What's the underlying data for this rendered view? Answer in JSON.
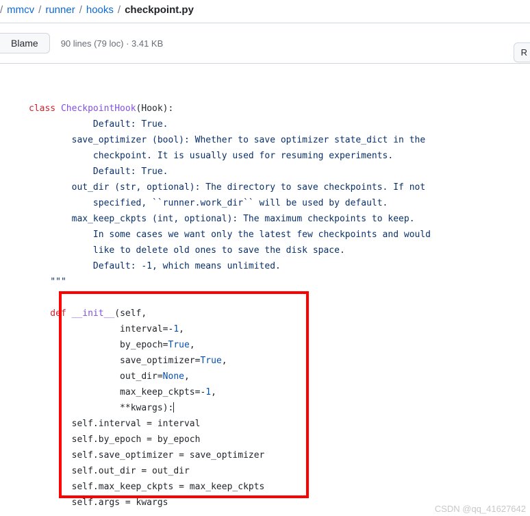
{
  "breadcrumb": {
    "seg0_sep": "/",
    "seg1": "mmcv",
    "seg2": "runner",
    "seg3": "hooks",
    "file": "checkpoint.py"
  },
  "toolbar": {
    "blame": "Blame",
    "info": "90 lines (79 loc) · 3.41 KB",
    "right": "R"
  },
  "code": {
    "l01_class": "class ",
    "l01_name": "CheckpointHook",
    "l01_paren": "(Hook):",
    "l02": "            Default: True.",
    "l03": "        save_optimizer (bool): Whether to save optimizer state_dict in the",
    "l04": "            checkpoint. It is usually used for resuming experiments.",
    "l05": "            Default: True.",
    "l06": "        out_dir (str, optional): The directory to save checkpoints. If not",
    "l07": "            specified, ``runner.work_dir`` will be used by default.",
    "l08": "        max_keep_ckpts (int, optional): The maximum checkpoints to keep.",
    "l09": "            In some cases we want only the latest few checkpoints and would",
    "l10": "            like to delete old ones to save the disk space.",
    "l11": "            Default: -1, which means unlimited.",
    "l12": "    \"\"\"",
    "l14_def": "    def ",
    "l14_fn": "__init__",
    "l14_open": "(",
    "l14_self": "self",
    "l14_comma": ",",
    "l15_a": "                 interval",
    "l15_b": "=-",
    "l15_c": "1",
    "l15_d": ",",
    "l16_a": "                 by_epoch",
    "l16_b": "=",
    "l16_c": "True",
    "l16_d": ",",
    "l17_a": "                 save_optimizer",
    "l17_b": "=",
    "l17_c": "True",
    "l17_d": ",",
    "l18_a": "                 out_dir",
    "l18_b": "=",
    "l18_c": "None",
    "l18_d": ",",
    "l19_a": "                 max_keep_ckpts",
    "l19_b": "=-",
    "l19_c": "1",
    "l19_d": ",",
    "l20_a": "                 **",
    "l20_b": "kwargs",
    "l20_c": "):",
    "l21": "        self.interval = interval",
    "l22": "        self.by_epoch = by_epoch",
    "l23": "        self.save_optimizer = save_optimizer",
    "l24": "        self.out_dir = out_dir",
    "l25": "        self.max_keep_ckpts = max_keep_ckpts",
    "l26": "        self.args = kwargs"
  },
  "watermark": "CSDN @qq_41627642"
}
